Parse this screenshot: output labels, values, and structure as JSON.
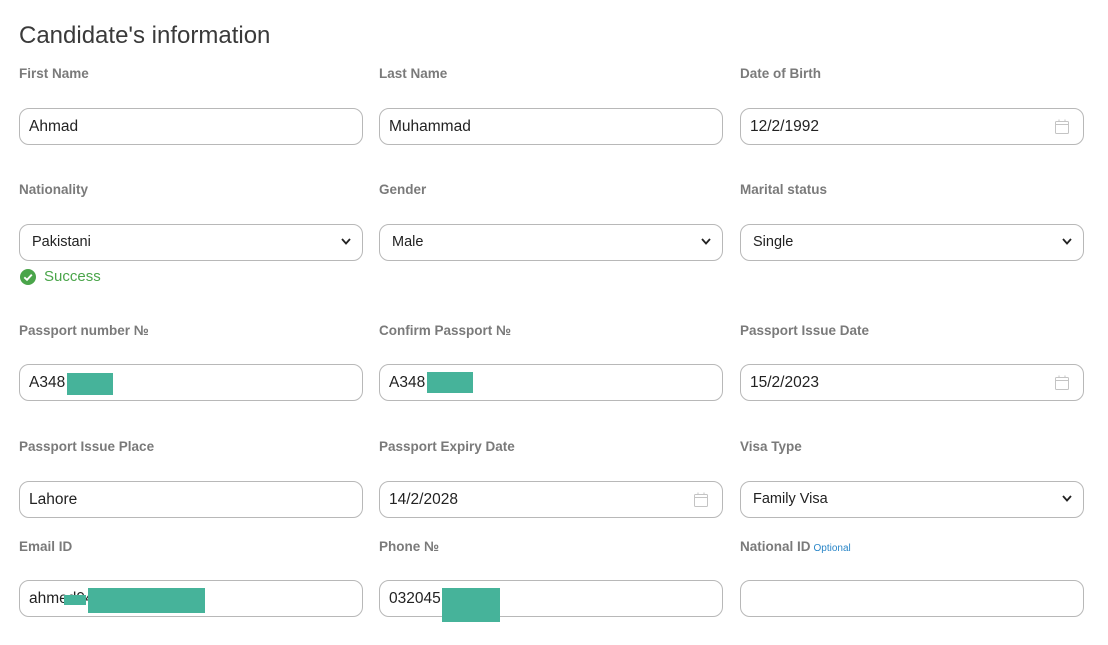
{
  "heading": "Candidate's information",
  "fields": {
    "first_name": {
      "label": "First Name",
      "value": "Ahmad"
    },
    "last_name": {
      "label": "Last Name",
      "value": "Muhammad"
    },
    "dob": {
      "label": "Date of Birth",
      "value": "12/2/1992"
    },
    "nationality": {
      "label": "Nationality",
      "value": "Pakistani"
    },
    "gender": {
      "label": "Gender",
      "value": "Male"
    },
    "marital": {
      "label": "Marital status",
      "value": "Single"
    },
    "passport": {
      "label": "Passport number №",
      "value": "A348"
    },
    "confirm_passport": {
      "label": "Confirm Passport №",
      "value": "A348"
    },
    "issue_date": {
      "label": "Passport Issue Date",
      "value": "15/2/2023"
    },
    "issue_place": {
      "label": "Passport Issue Place",
      "value": "Lahore"
    },
    "expiry_date": {
      "label": "Passport Expiry Date",
      "value": "14/2/2028"
    },
    "visa_type": {
      "label": "Visa Type",
      "value": "Family Visa"
    },
    "email": {
      "label": "Email ID",
      "value": "ahmed94"
    },
    "phone": {
      "label": "Phone №",
      "value": "032045"
    },
    "national_id": {
      "label": "National ID",
      "optional": "Optional",
      "value": ""
    }
  },
  "nationality_status": "Success",
  "colors": {
    "success": "#4aa54a",
    "redaction": "#46b39a",
    "optional": "#2a86c8"
  }
}
